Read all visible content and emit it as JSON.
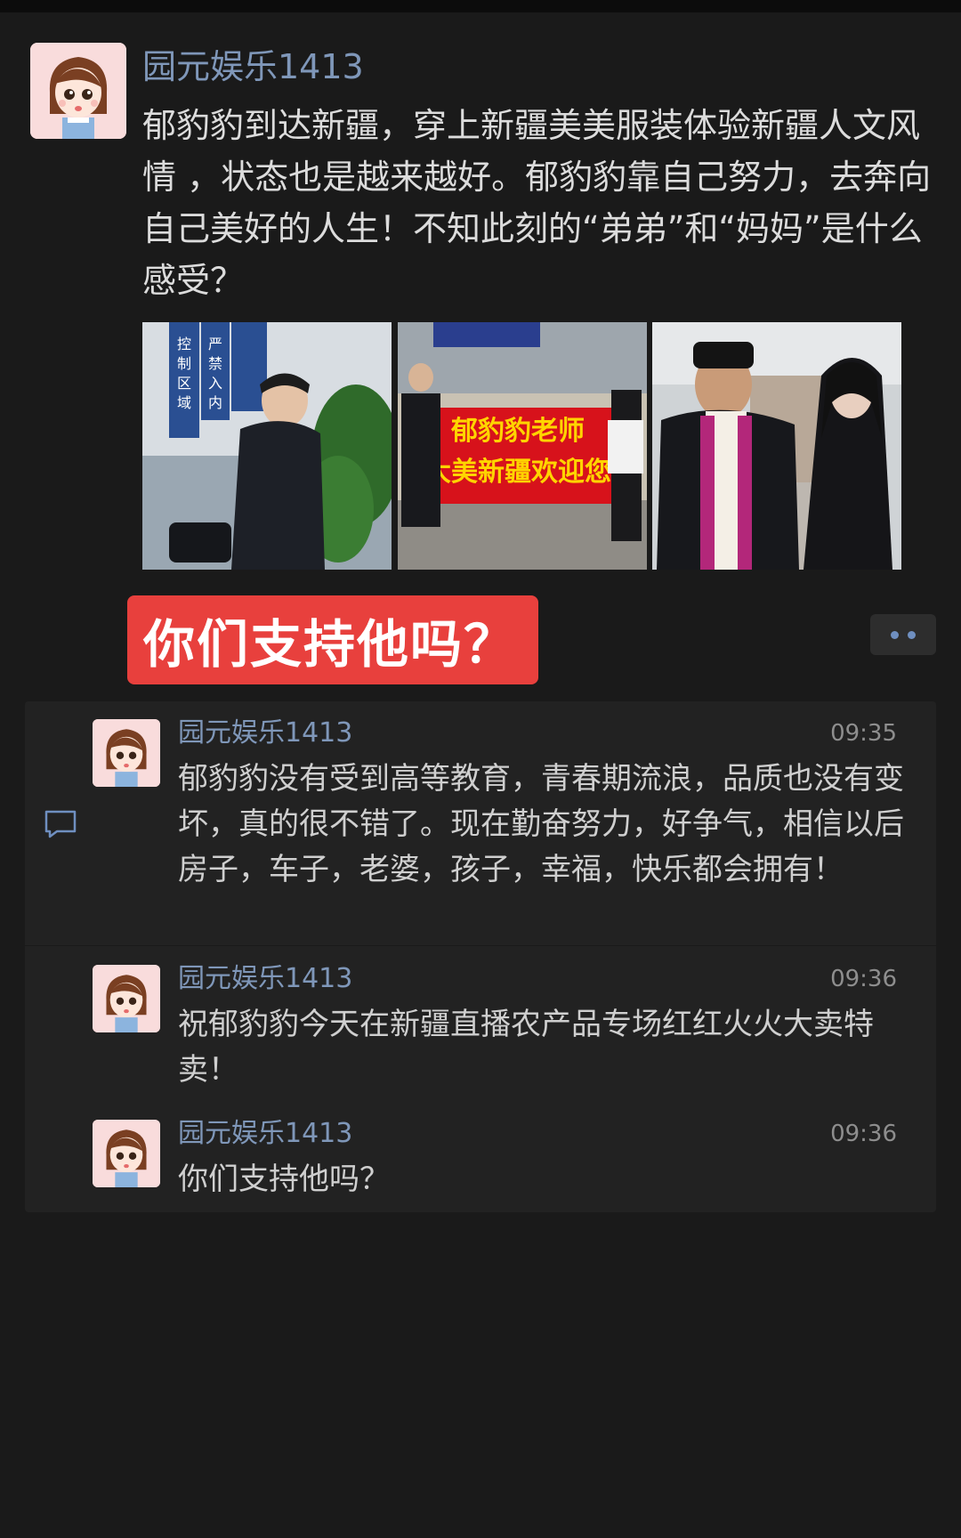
{
  "post": {
    "author": "园元娱乐1413",
    "text": "郁豹豹到达新疆，穿上新疆美美服装体验新疆人文风情 ，状态也是越来越好。郁豹豹靠自己努力，去奔向自己美好的人生！不知此刻的“弟弟”和“妈妈”是什么感受？",
    "photos": [
      {
        "sign_text": [
          "控",
          "制",
          "区",
          "域",
          "严",
          "禁",
          "入",
          "内"
        ]
      },
      {
        "banner_line1": "郁豹豹老师",
        "banner_line2": "大美新疆欢迎您"
      },
      {}
    ],
    "question_banner": "你们支持他吗？"
  },
  "comments": [
    {
      "author": "园元娱乐1413",
      "time": "09:35",
      "text": "郁豹豹没有受到高等教育，青春期流浪，品质也没有变坏，真的很不错了。现在勤奋努力，好争气，相信以后房子，车子，老婆，孩子，幸福，快乐都会拥有！"
    },
    {
      "author": "园元娱乐1413",
      "time": "09:36",
      "text": "祝郁豹豹今天在新疆直播农产品专场红红火火大卖特卖！"
    },
    {
      "author": "园元娱乐1413",
      "time": "09:36",
      "text": "你们支持他吗？"
    }
  ],
  "colors": {
    "background": "#1a1a1a",
    "name_link": "#7f97b9",
    "banner_red": "#e8403d"
  }
}
